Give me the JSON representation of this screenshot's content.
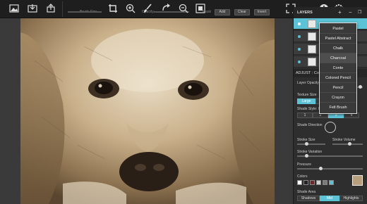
{
  "toolbar": {
    "icons": [
      "open-image-icon",
      "export-icon",
      "share-icon",
      "crop-icon",
      "zoom-in-icon",
      "brush-icon",
      "rotate-icon",
      "zoom-out-icon",
      "fit-icon",
      "fullscreen-icon",
      "info-icon",
      "settings-icon"
    ],
    "brush_size_label": "Brush Size",
    "opacity_label": "Opacity",
    "mask_label": "Mask",
    "mask_add": "Add",
    "mask_clear": "Clear",
    "mask_invert": "Invert"
  },
  "layers": {
    "title": "LAYERS",
    "add": "+",
    "remove": "−",
    "rows": [
      {
        "selected": true
      },
      {
        "selected": false
      },
      {
        "selected": false
      },
      {
        "selected": false
      }
    ]
  },
  "adjust": {
    "title": "ADJUST : Conte",
    "layer_opacity_label": "Layer Opacity",
    "texture_size_label": "Texture Size",
    "texture_size_selected": "Large",
    "shade_style_label": "Shade Style: Cro",
    "shade_style_options": [
      "1",
      "2",
      "3",
      "4"
    ],
    "shade_direction_label": "Shade Direction",
    "stroke_size_label": "Stroke Size",
    "stroke_volume_label": "Stroke Volume",
    "stroke_variation_label": "Stroke Variation",
    "pressure_label": "Pressure",
    "colors_label": "Colors",
    "swatches": [
      "#ffffff",
      "#222222",
      "#6a2a2a",
      "#cfcfcf",
      "#7a7a7a",
      "#5cc3d6"
    ],
    "shade_area_label": "Shade Area",
    "shade_area_options": [
      "Shadows",
      "Mid",
      "Highlights"
    ],
    "shade_area_selected": "Mid",
    "accent": "#5cc3d6"
  },
  "menu": {
    "items": [
      "Pastel",
      "Pastel Abstract",
      "Chalk",
      "Charcoal",
      "Conte",
      "Colored Pencil",
      "Pencil",
      "Crayon",
      "Felt Brush"
    ],
    "highlighted": "Charcoal"
  }
}
